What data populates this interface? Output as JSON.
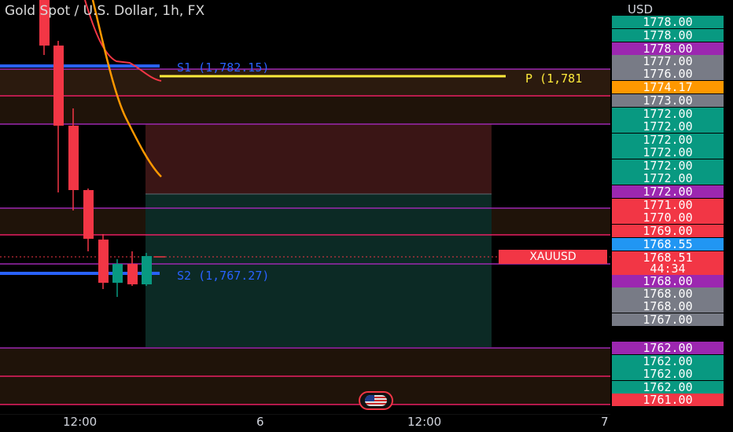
{
  "header": {
    "title": "Gold Spot / U.S. Dollar, 1h, FX"
  },
  "axis": {
    "currency": "USD"
  },
  "levels": {
    "s1_label": "S1 (1,782.15)",
    "s2_label": "S2 (1,767.27)",
    "p_label": "P (1,781"
  },
  "symbol_tag": "XAUUSD",
  "countdown": "44:34",
  "price_labels": [
    {
      "text": "1778.00",
      "color": "#089981"
    },
    {
      "text": "1778.00",
      "color": "#089981"
    },
    {
      "text": "1778.00",
      "color": "#9c27b0"
    },
    {
      "text": "1777.00",
      "color": "#787b86"
    },
    {
      "text": "1776.00",
      "color": "#787b86"
    },
    {
      "text": "1774.17",
      "color": "#ff9800"
    },
    {
      "text": "1773.00",
      "color": "#787b86"
    },
    {
      "text": "1772.00",
      "color": "#089981"
    },
    {
      "text": "1772.00",
      "color": "#089981"
    },
    {
      "text": "1772.00",
      "color": "#089981"
    },
    {
      "text": "1772.00",
      "color": "#089981"
    },
    {
      "text": "1772.00",
      "color": "#089981"
    },
    {
      "text": "1772.00",
      "color": "#089981"
    },
    {
      "text": "1772.00",
      "color": "#9c27b0"
    },
    {
      "text": "1771.00",
      "color": "#f23645"
    },
    {
      "text": "1770.00",
      "color": "#f23645"
    },
    {
      "text": "1769.00",
      "color": "#f23645"
    },
    {
      "text": "1768.55",
      "color": "#2196f3"
    },
    {
      "text": "1768.51",
      "color": "#f23645"
    },
    {
      "text": "1768.00",
      "color": "#9c27b0"
    },
    {
      "text": "1768.00",
      "color": "#787b86"
    },
    {
      "text": "1768.00",
      "color": "#787b86"
    },
    {
      "text": "1767.00",
      "color": "#787b86"
    },
    {
      "text": "1762.00",
      "color": "#9c27b0"
    },
    {
      "text": "1762.00",
      "color": "#089981"
    },
    {
      "text": "1762.00",
      "color": "#089981"
    },
    {
      "text": "1762.00",
      "color": "#089981"
    },
    {
      "text": "1761.00",
      "color": "#f23645"
    }
  ],
  "time_labels": [
    "12:00",
    "6",
    "12:00",
    "7"
  ],
  "colors": {
    "up": "#089981",
    "down": "#f23645",
    "support": "#2962ff",
    "pivot": "#ffeb3b",
    "ma": "#ff9800",
    "level_line": "#9c27b0"
  }
}
